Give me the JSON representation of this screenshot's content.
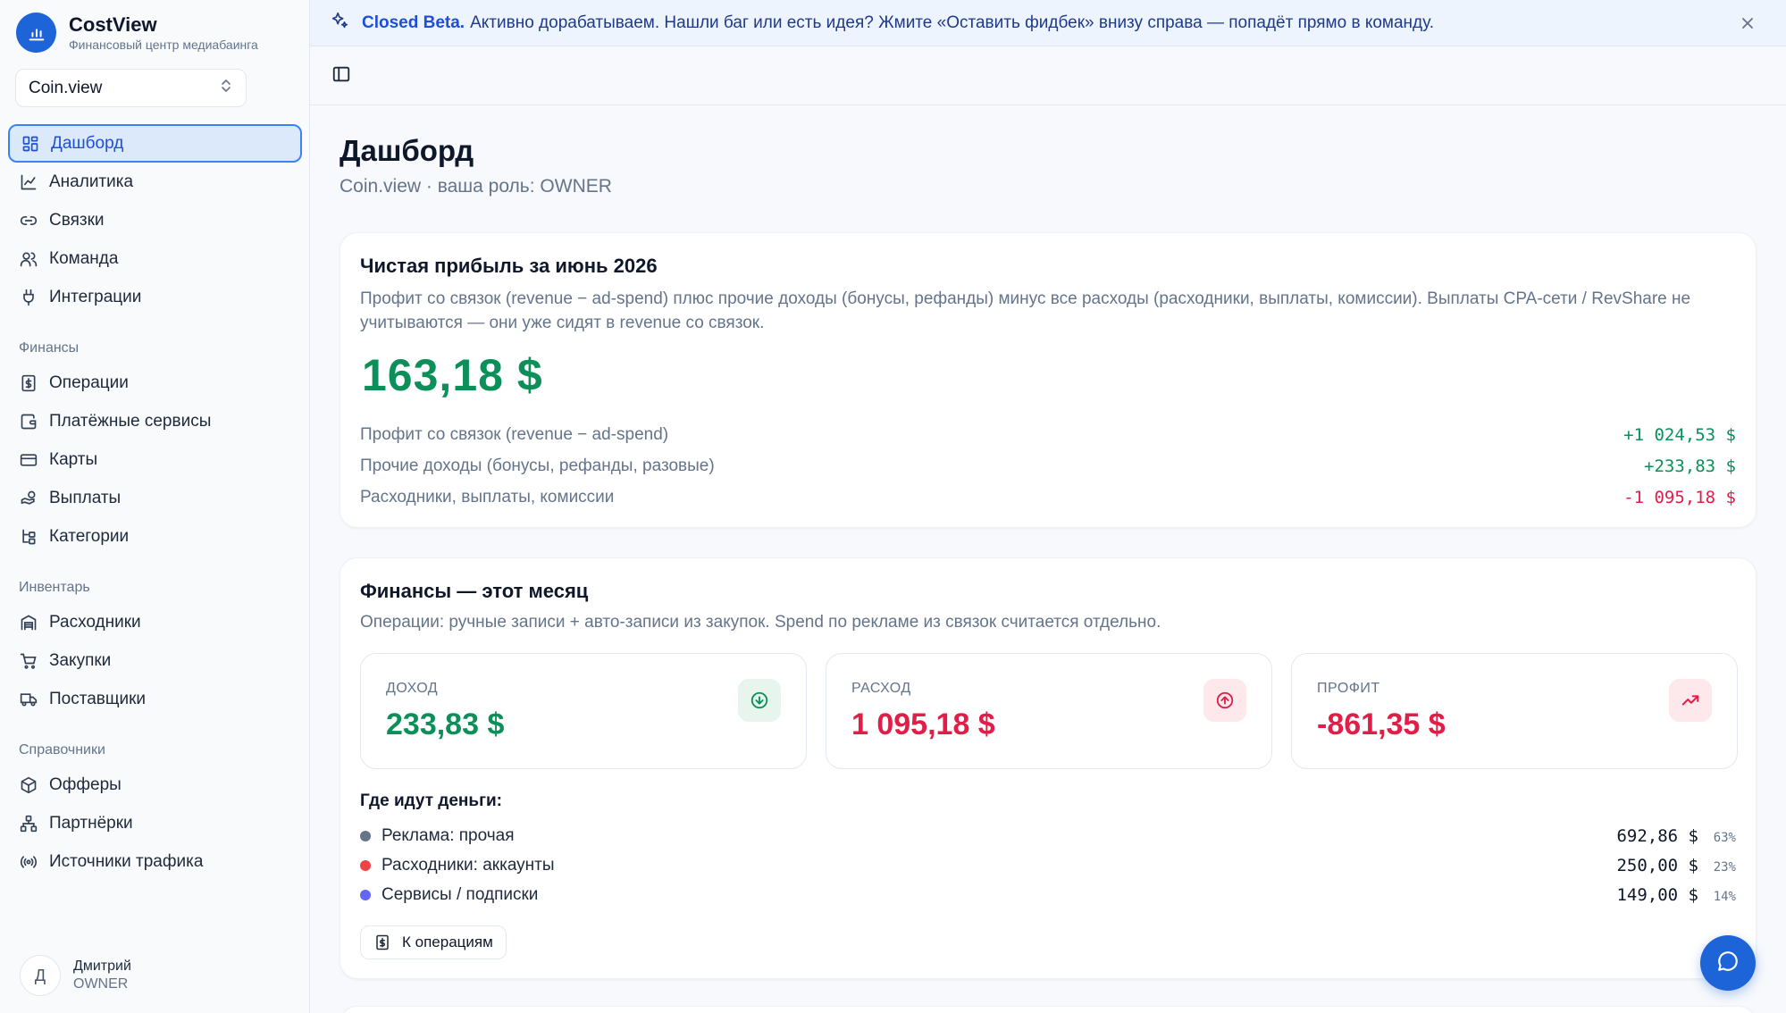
{
  "brand": {
    "name": "CostView",
    "subtitle": "Финансовый центр медиабаинга",
    "logo_icon": "bar-chart-icon",
    "color": "#1d64d8"
  },
  "project_selector": {
    "value": "Coin.view",
    "icon": "chevron-up-down-icon"
  },
  "sidebar": {
    "main": [
      {
        "label": "Дашборд",
        "icon": "dashboard-grid-icon",
        "active": true
      },
      {
        "label": "Аналитика",
        "icon": "line-chart-icon"
      },
      {
        "label": "Связки",
        "icon": "link-icon"
      },
      {
        "label": "Команда",
        "icon": "users-icon"
      },
      {
        "label": "Интеграции",
        "icon": "plug-icon"
      }
    ],
    "finance_title": "Финансы",
    "finance": [
      {
        "label": "Операции",
        "icon": "receipt-icon"
      },
      {
        "label": "Платёжные сервисы",
        "icon": "wallet-icon"
      },
      {
        "label": "Карты",
        "icon": "credit-card-icon"
      },
      {
        "label": "Выплаты",
        "icon": "hand-coins-icon"
      },
      {
        "label": "Категории",
        "icon": "tree-icon"
      }
    ],
    "inventory_title": "Инвентарь",
    "inventory": [
      {
        "label": "Расходники",
        "icon": "warehouse-icon"
      },
      {
        "label": "Закупки",
        "icon": "cart-icon"
      },
      {
        "label": "Поставщики",
        "icon": "truck-icon"
      }
    ],
    "refs_title": "Справочники",
    "refs": [
      {
        "label": "Офферы",
        "icon": "box-icon"
      },
      {
        "label": "Партнёрки",
        "icon": "network-icon"
      },
      {
        "label": "Источники трафика",
        "icon": "radio-icon"
      }
    ]
  },
  "user": {
    "initial": "Д",
    "name": "Дмитрий",
    "role": "OWNER"
  },
  "banner": {
    "title": "Closed Beta.",
    "text": "Активно дорабатываем. Нашли баг или есть идея? Жмите «Оставить фидбек» внизу справа — попадёт прямо в команду.",
    "icon": "sparkles-icon"
  },
  "page": {
    "title": "Дашборд",
    "subtitle": "Coin.view · ваша роль: OWNER"
  },
  "net_profit": {
    "title": "Чистая прибыль за июнь 2026",
    "description": "Профит со связок (revenue − ad-spend) плюс прочие доходы (бонусы, рефанды) минус все расходы (расходники, выплаты, комиссии). Выплаты CPA-сети / RevShare не учитываются — они уже сидят в revenue со связок.",
    "value": "163,18 $",
    "breakdown": [
      {
        "label": "Профит со связок (revenue − ad-spend)",
        "value": "+1 024,53 $",
        "sign": "pos"
      },
      {
        "label": "Прочие доходы (бонусы, рефанды, разовые)",
        "value": "+233,83 $",
        "sign": "pos"
      },
      {
        "label": "Расходники, выплаты, комиссии",
        "value": "-1 095,18 $",
        "sign": "neg"
      }
    ]
  },
  "finance_month": {
    "title": "Финансы — этот месяц",
    "description": "Операции: ручные записи + авто-записи из закупок. Spend по рекламе из связок считается отдельно.",
    "stats": [
      {
        "label": "ДОХОД",
        "value": "233,83 $",
        "color": "#0d8f5a",
        "icon": "arrow-down-circle-icon",
        "icon_bg": "#e8f5ee"
      },
      {
        "label": "РАСХОД",
        "value": "1 095,18 $",
        "color": "#e11d48",
        "icon": "arrow-up-circle-icon",
        "icon_bg": "#fde8ec"
      },
      {
        "label": "ПРОФИТ",
        "value": "-861,35 $",
        "color": "#e11d48",
        "icon": "trending-up-icon",
        "icon_bg": "#fde8ec"
      }
    ],
    "where_title": "Где идут деньги:",
    "where": [
      {
        "label": "Реклама: прочая",
        "amount": "692,86 $",
        "pct": "63%",
        "color": "#64748b"
      },
      {
        "label": "Расходники: аккаунты",
        "amount": "250,00 $",
        "pct": "23%",
        "color": "#ef4444"
      },
      {
        "label": "Сервисы / подписки",
        "amount": "149,00 $",
        "pct": "14%",
        "color": "#6366f1"
      }
    ],
    "ops_button": "К операциям"
  },
  "chat_button_icon": "message-circle-icon"
}
